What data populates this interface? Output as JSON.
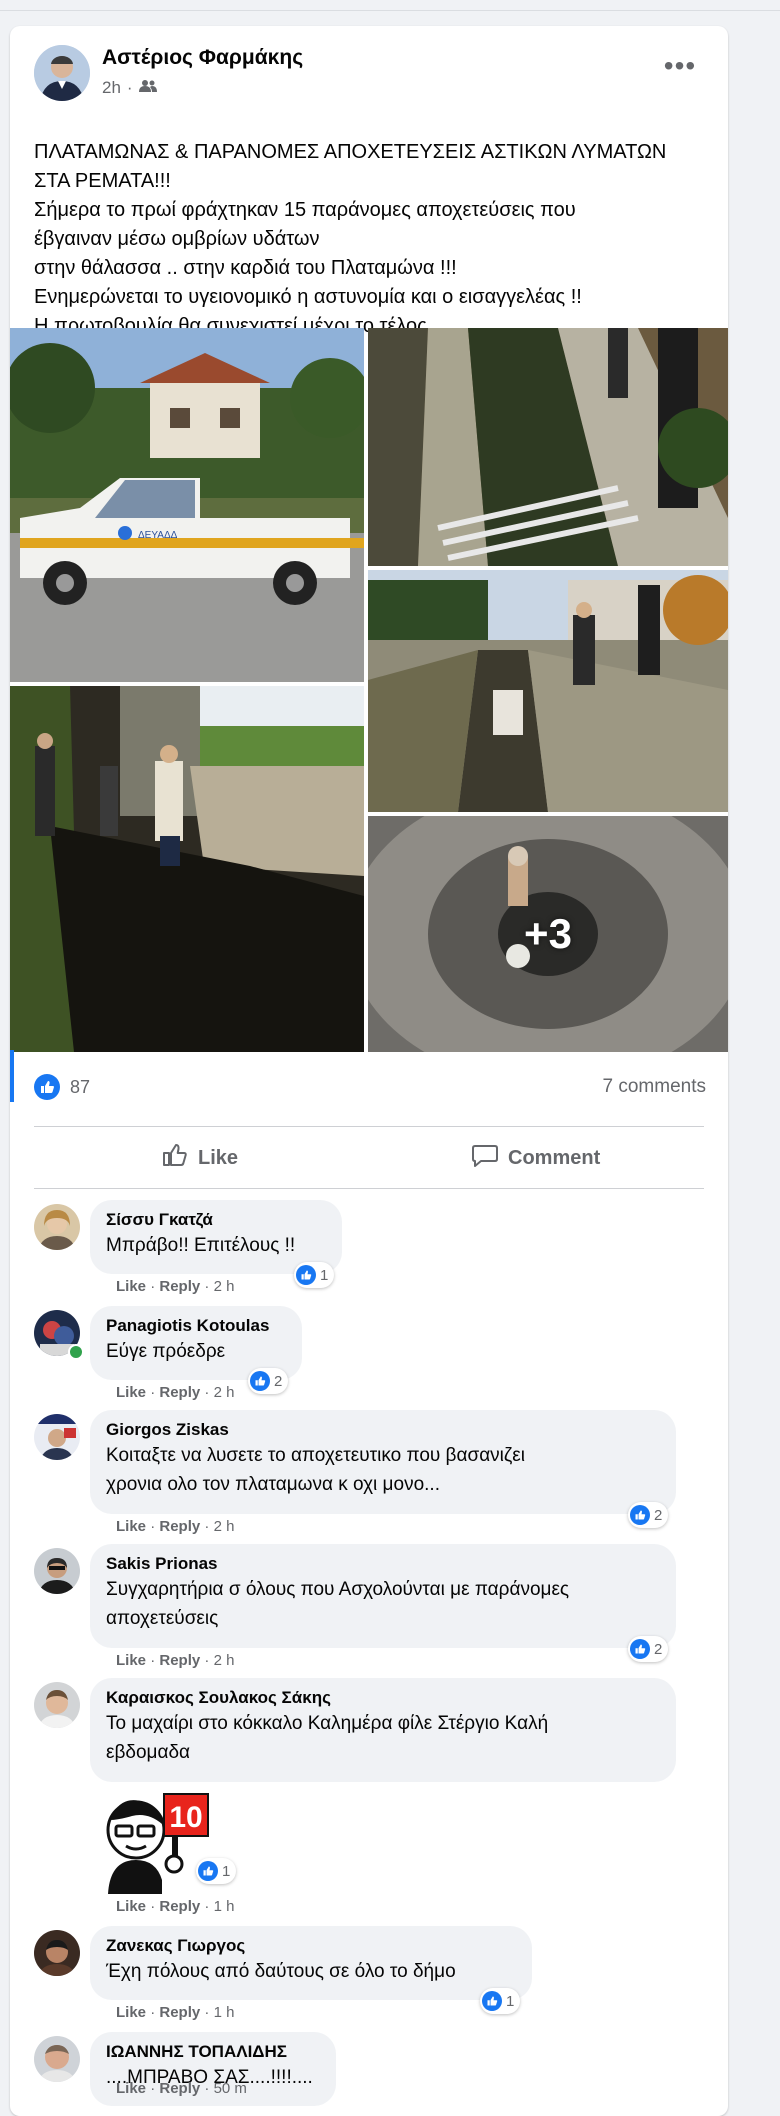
{
  "post": {
    "author": "Αστέριος Φαρμάκης",
    "time": "2h",
    "dot": "·",
    "more_label": "•••",
    "text_lines": [
      "ΠΛΑΤΑΜΩΝΑΣ & ΠΑΡΑΝΟΜΕΣ ΑΠΟΧΕΤΕΥΣΕΙΣ ΑΣΤΙΚΩΝ ΛΥΜΑΤΩΝ",
      "ΣΤΑ ΡΕΜΑΤΑ!!!",
      "Σήμερα το πρωί φράχτηκαν 15 παράνομες αποχετεύσεις που",
      "έβγαιναν μέσω ομβρίων υδάτων",
      "στην θάλασσα .. στην καρδιά του Πλαταμώνα !!!",
      "Ενημερώνεται το υγειονομικό η αστυνομία και ο εισαγγελέας !!",
      "Η πρωτοβουλία θα συνεχιστεί μέχρι το τέλος .."
    ],
    "more_photos": "+3",
    "truck_label": "ΔΕΥΑΔΔ",
    "reactions_count": "87",
    "comments_count": "7 comments",
    "like_label": "Like",
    "comment_label": "Comment"
  },
  "comment_actions": {
    "like": "Like",
    "reply": "Reply",
    "sep": "·"
  },
  "comments": [
    {
      "name": "Σίσσυ Γκατζά",
      "lines": [
        "Μπράβο!! Επιτέλους !!"
      ],
      "time": "2 h",
      "likes": "1"
    },
    {
      "name": "Panagiotis Kotoulas",
      "lines": [
        "Εύγε πρόεδρε"
      ],
      "time": "2 h",
      "likes": "2"
    },
    {
      "name": "Giorgos Ziskas",
      "lines": [
        "Κοιταξτε να λυσετε το αποχετευτικο που βασανιζει",
        "χρονια ολο τον πλαταμωνα κ οχι μονο..."
      ],
      "time": "2 h",
      "likes": "2"
    },
    {
      "name": "Sakis Prionas",
      "lines": [
        "Συγχαρητήρια σ όλους που Ασχολούνται με παράνομες",
        "αποχετεύσεις"
      ],
      "time": "2 h",
      "likes": "2"
    },
    {
      "name": "Καραισκος Σουλακος Σάκης",
      "lines": [
        "Το μαχαίρι στο κόκκαλο Καλημέρα φίλε Στέργιο Καλή",
        "εβδομαδα"
      ],
      "time": "1 h",
      "likes": "1",
      "sticker_text": "10"
    },
    {
      "name": "Ζανεκας Γιωργος",
      "lines": [
        "Έχη πόλους από δαύτους σε όλο το δήμο"
      ],
      "time": "1 h",
      "likes": "1"
    },
    {
      "name": "ΙΩΑΝΝΗΣ ΤΟΠΑΛΙΔΗΣ",
      "lines": [
        "....ΜΠΡΑΒΟ ΣΑΣ....!!!!...."
      ],
      "time": "50 m",
      "likes": ""
    }
  ]
}
